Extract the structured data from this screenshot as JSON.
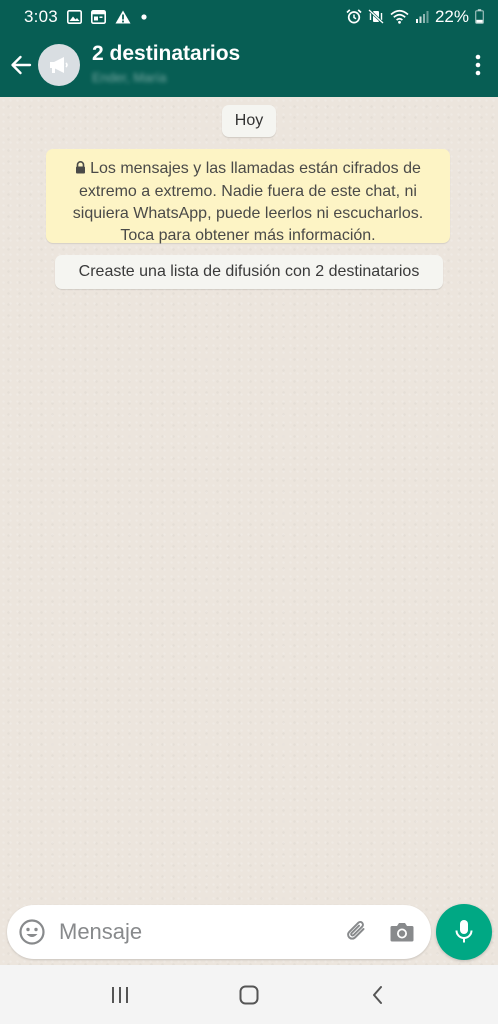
{
  "status_bar": {
    "time": "3:03",
    "battery_percent": "22%",
    "left_icons": [
      "gallery-icon",
      "calendar-icon",
      "warning-icon",
      "dot-icon"
    ],
    "right_icons": [
      "alarm-icon",
      "mute-vibrate-icon",
      "wifi-icon",
      "signal-icon",
      "battery-icon"
    ]
  },
  "header": {
    "title": "2 destinatarios",
    "subtitle": "Ender, María",
    "background_color": "#075e54"
  },
  "chat": {
    "date_label": "Hoy",
    "encryption_notice": "Los mensajes y las llamadas están cifrados de extremo a extremo. Nadie fuera de este chat, ni siquiera WhatsApp, puede leerlos ni escucharlos. Toca para obtener más información.",
    "encryption_notice_color": "#fdf4c5",
    "system_message": "Creaste una lista de difusión con 2 destinatarios",
    "background_color": "#ece5dd"
  },
  "composer": {
    "placeholder": "Mensaje",
    "value": "",
    "mic_button_color": "#00a884"
  },
  "nav_bar": {
    "icons": [
      "recent-apps-icon",
      "home-icon",
      "back-nav-icon"
    ]
  }
}
